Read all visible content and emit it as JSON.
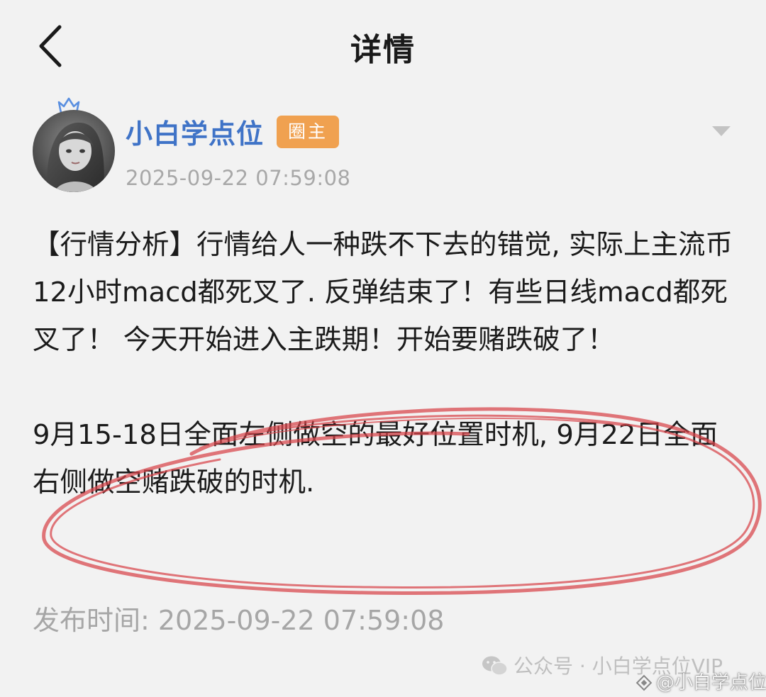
{
  "nav": {
    "title": "详情"
  },
  "post": {
    "author": "小白学点位",
    "badge": "圈主",
    "time": "2025-09-22 07:59:08",
    "paragraphs": [
      "【行情分析】行情给人一种跌不下去的错觉, 实际上主流币12小时macd都死叉了. 反弹结束了！有些日线macd都死叉了！  今天开始进入主跌期！开始要赌跌破了！",
      "9月15-18日全面左侧做空的最好位置时机, 9月22日全面右侧做空赌跌破的时机."
    ],
    "publish_label": "发布时间: 2025-09-22 07:59:08"
  },
  "watermarks": {
    "wechat": "公众号 · 小白学点位VIP",
    "handle": "@小白学点位"
  },
  "colors": {
    "background": "#f2f2f2",
    "author": "#3f73c7",
    "badge": "#f0a150",
    "meta": "#a8a8a8",
    "annotation": "#d9444a"
  },
  "icons": [
    "back-chevron-icon",
    "crown-icon",
    "dropdown-triangle-icon",
    "wechat-icon",
    "diamond-icon"
  ]
}
